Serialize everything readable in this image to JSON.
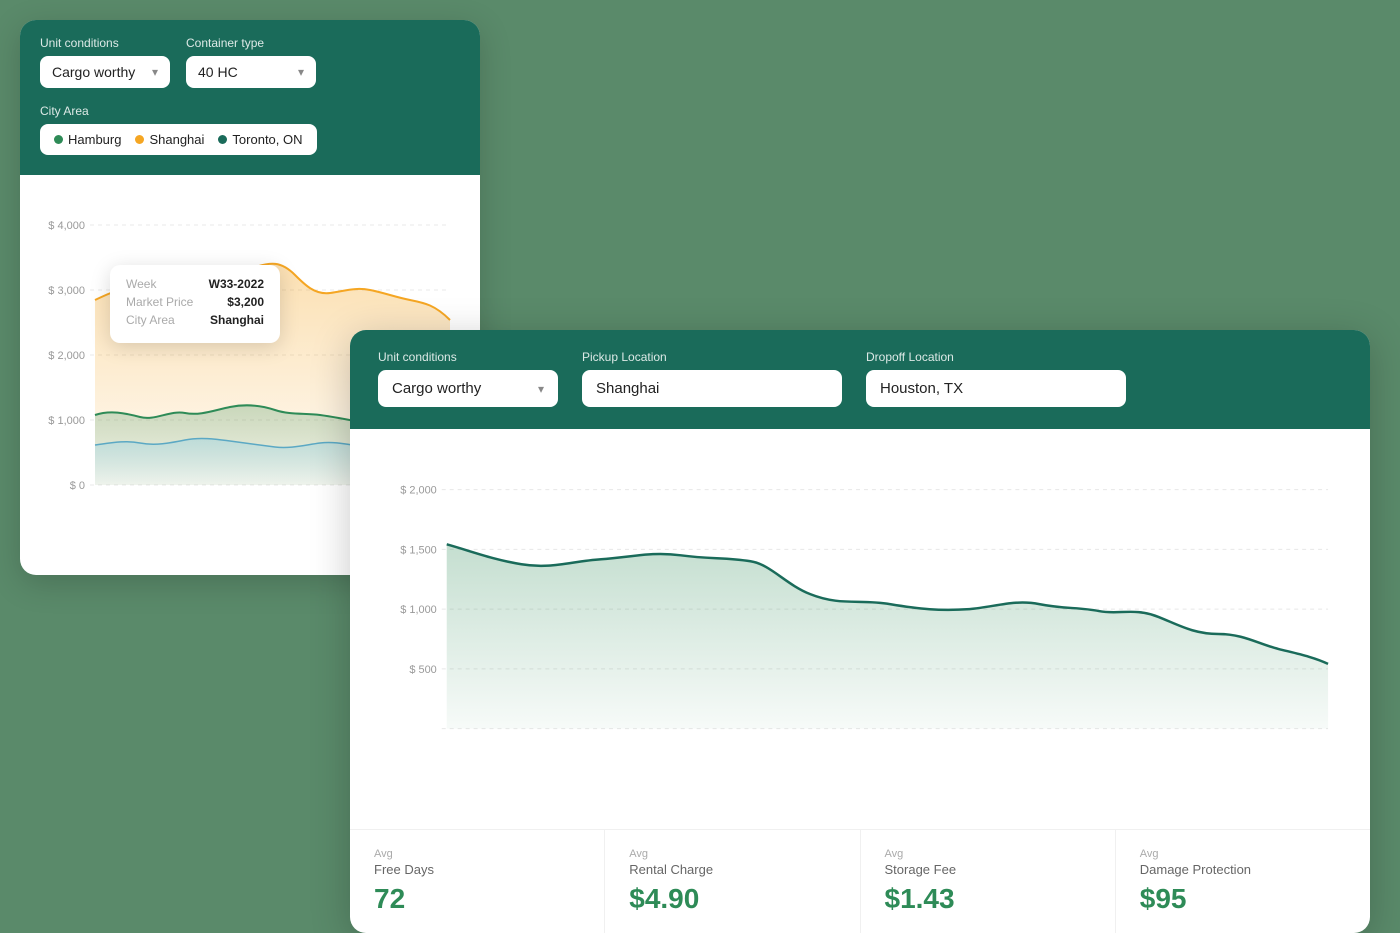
{
  "card_back": {
    "header": {
      "unit_conditions_label": "Unit conditions",
      "container_type_label": "Container type",
      "city_area_label": "City Area",
      "unit_conditions_value": "Cargo worthy",
      "container_type_value": "40 HC",
      "cities": [
        {
          "name": "Hamburg",
          "color": "green"
        },
        {
          "name": "Shanghai",
          "color": "orange"
        },
        {
          "name": "Toronto, ON",
          "color": "teal"
        }
      ]
    },
    "tooltip": {
      "week_label": "Week",
      "week_value": "W33-2022",
      "market_price_label": "Market Price",
      "market_price_value": "$3,200",
      "city_area_label": "City Area",
      "city_area_value": "Shanghai"
    },
    "y_axis": [
      "$ 4,000",
      "$ 3,000",
      "$ 2,000",
      "$ 1,000",
      "$ 0"
    ]
  },
  "card_front": {
    "header": {
      "unit_conditions_label": "Unit conditions",
      "pickup_location_label": "Pickup Location",
      "dropoff_location_label": "Dropoff Location",
      "unit_conditions_value": "Cargo worthy",
      "pickup_location_value": "Shanghai",
      "dropoff_location_value": "Houston, TX"
    },
    "y_axis": [
      "$ 2,000",
      "$ 1,500",
      "$ 1,000",
      "$ 500"
    ],
    "stats": [
      {
        "avg": "Avg",
        "label": "Free Days",
        "value": "72"
      },
      {
        "avg": "Avg",
        "label": "Rental Charge",
        "value": "$4.90"
      },
      {
        "avg": "Avg",
        "label": "Storage Fee",
        "value": "$1.43"
      },
      {
        "avg": "Avg",
        "label": "Damage Protection",
        "value": "$95"
      }
    ]
  }
}
